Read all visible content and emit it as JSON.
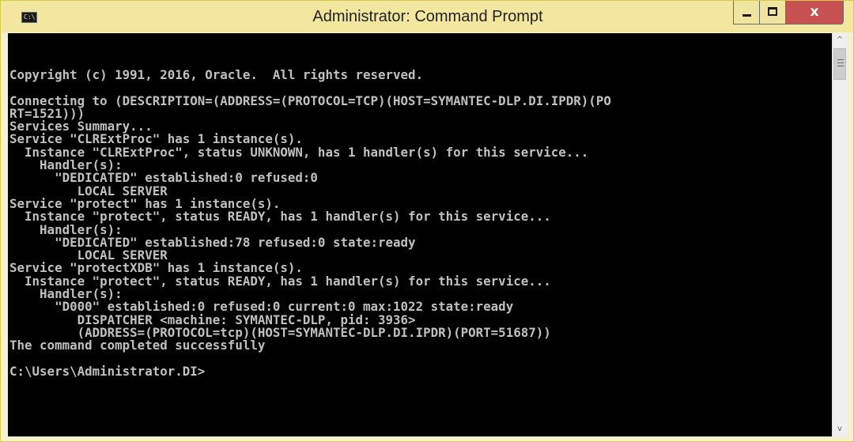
{
  "window": {
    "title": "Administrator: Command Prompt",
    "icon": "cmd-icon",
    "icon_glyph": "C:\\",
    "close_glyph": "x"
  },
  "colors": {
    "title_bar": "#f3e7a0",
    "close_button": "#c75050",
    "console_bg": "#000000",
    "console_text": "#c0c0c0"
  },
  "console": {
    "lines": [
      "Copyright (c) 1991, 2016, Oracle.  All rights reserved.",
      "",
      "Connecting to (DESCRIPTION=(ADDRESS=(PROTOCOL=TCP)(HOST=SYMANTEC-DLP.DI.IPDR)(PO",
      "RT=1521)))",
      "Services Summary...",
      "Service \"CLRExtProc\" has 1 instance(s).",
      "  Instance \"CLRExtProc\", status UNKNOWN, has 1 handler(s) for this service...",
      "    Handler(s):",
      "      \"DEDICATED\" established:0 refused:0",
      "         LOCAL SERVER",
      "Service \"protect\" has 1 instance(s).",
      "  Instance \"protect\", status READY, has 1 handler(s) for this service...",
      "    Handler(s):",
      "      \"DEDICATED\" established:78 refused:0 state:ready",
      "         LOCAL SERVER",
      "Service \"protectXDB\" has 1 instance(s).",
      "  Instance \"protect\", status READY, has 1 handler(s) for this service...",
      "    Handler(s):",
      "      \"D000\" established:0 refused:0 current:0 max:1022 state:ready",
      "         DISPATCHER <machine: SYMANTEC-DLP, pid: 3936>",
      "         (ADDRESS=(PROTOCOL=tcp)(HOST=SYMANTEC-DLP.DI.IPDR)(PORT=51687))",
      "The command completed successfully",
      "",
      "C:\\Users\\Administrator.DI>"
    ]
  },
  "scrollbar": {
    "up_arrow": "^",
    "down_arrow": "v",
    "position": 0
  }
}
